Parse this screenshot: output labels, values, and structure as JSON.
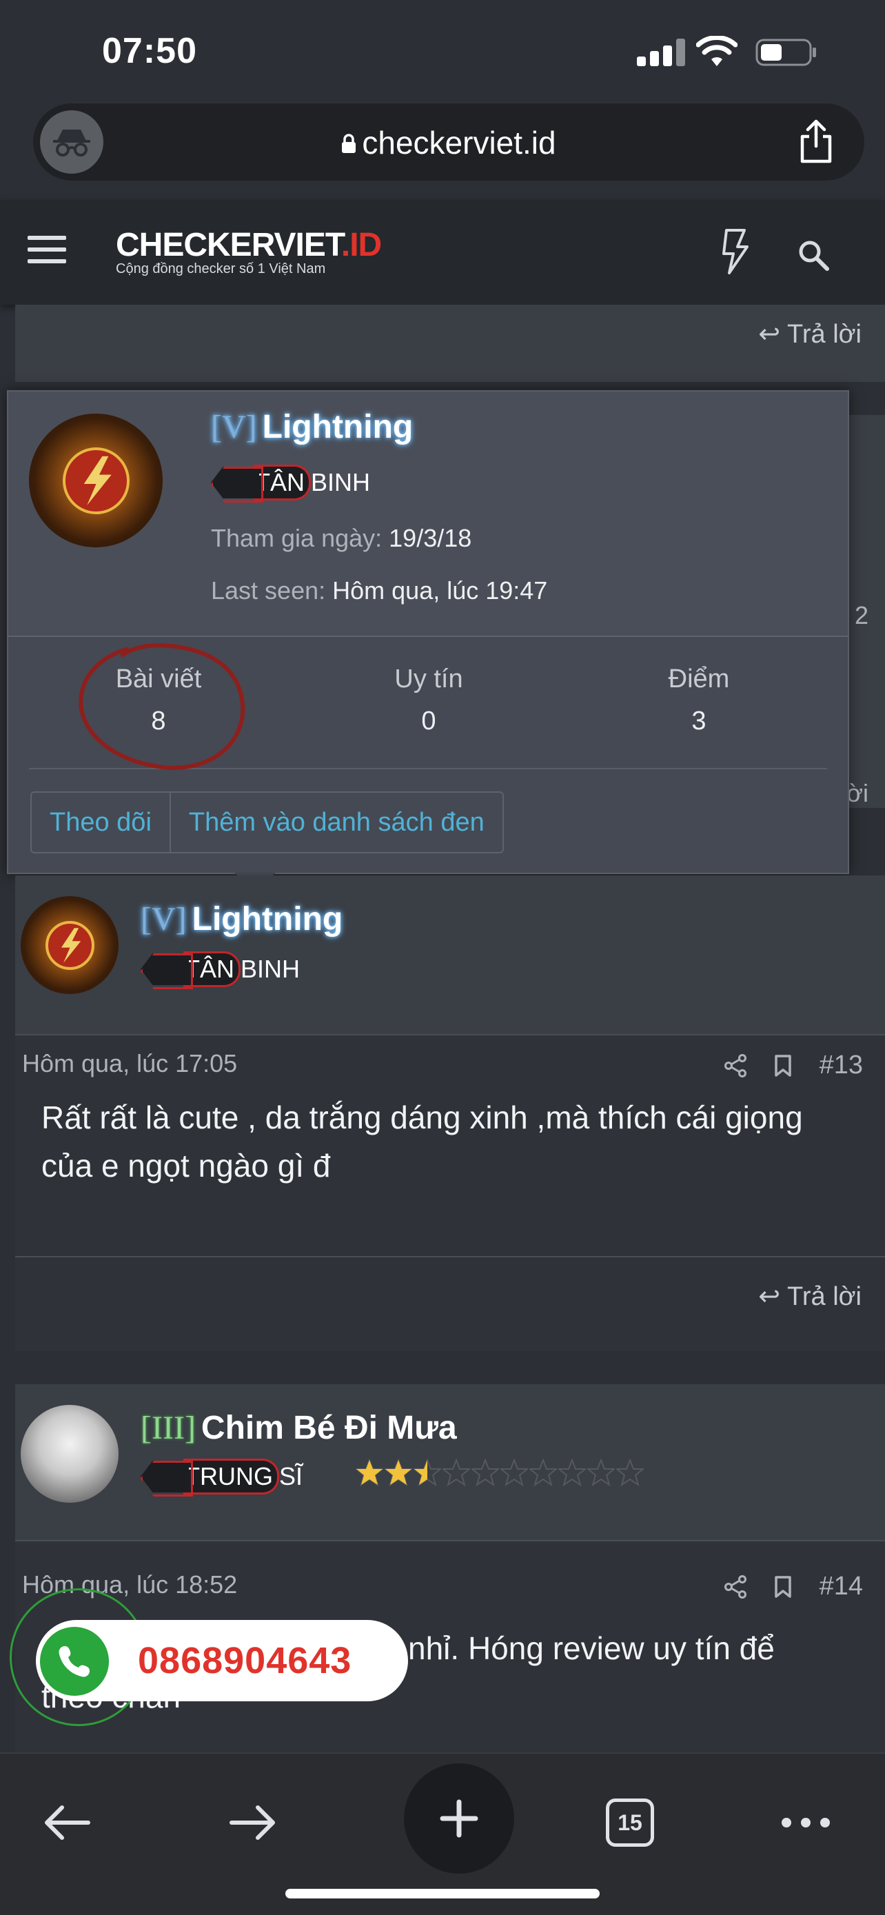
{
  "status_bar": {
    "time": "07:50"
  },
  "browser": {
    "url": "checkerviet.id"
  },
  "site": {
    "logo_main": "CHECKERVIET",
    "logo_accent": ".ID",
    "tagline": "Cộng đồng checker số 1 Việt Nam"
  },
  "reply_label": "Trả lời",
  "tooltip": {
    "rank_tag": "[V]",
    "username": "Lightning",
    "badge_highlight": "TÂN",
    "badge_rest": " BINH",
    "joined_label": "Tham gia ngày:",
    "joined_value": "19/3/18",
    "last_seen_label": "Last seen:",
    "last_seen_value": "Hôm qua, lúc 19:47",
    "stats": [
      {
        "label": "Bài viết",
        "value": "8"
      },
      {
        "label": "Uy tín",
        "value": "0"
      },
      {
        "label": "Điểm",
        "value": "3"
      }
    ],
    "follow_button": "Theo dõi",
    "block_button": "Thêm vào danh sách đen"
  },
  "peek_numbers": {
    "a": "2",
    "b": "ời"
  },
  "post13": {
    "rank_tag": "[V]",
    "username": "Lightning",
    "badge_highlight": "TÂN",
    "badge_rest": " BINH",
    "time": "Hôm qua, lúc 17:05",
    "number": "#13",
    "text": "Rất rất là cute , da trắng dáng xinh ,mà thích cái giọng của e ngọt ngào gì đ"
  },
  "post14": {
    "rank_tag": "[III]",
    "username": "Chim Bé Đi Mưa",
    "badge_highlight": "TRUNG",
    "badge_rest": " SĨ",
    "stars_rating": 2.5,
    "stars_total": 10,
    "time": "Hôm qua, lúc 18:52",
    "number": "#14",
    "text_visible": "nhỉ. Hóng review uy tín để",
    "text_line2": "theo chân"
  },
  "phone": {
    "number": "0868904643"
  },
  "toolbar": {
    "tabs_count": "15"
  },
  "colors": {
    "background": "#2c2f35",
    "card": "#3a3e45",
    "accent_blue": "#4fb3d8",
    "brand_red": "#e0332b",
    "phone_green": "#29a63c"
  }
}
